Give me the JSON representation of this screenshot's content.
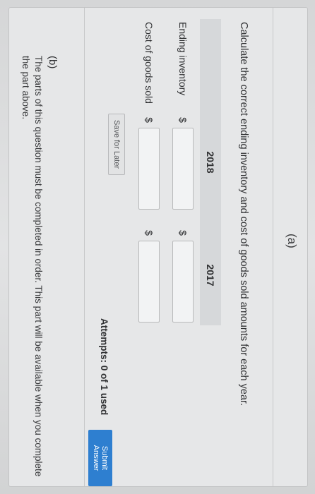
{
  "part_a": {
    "label": "(a)",
    "instructions": "Calculate the correct ending inventory and cost of goods sold amounts for each year.",
    "table": {
      "columns": [
        "2018",
        "2017"
      ],
      "rows": [
        {
          "label": "Ending inventory",
          "currency": "$",
          "values": [
            "",
            ""
          ]
        },
        {
          "label": "Cost of goods sold",
          "currency": "$",
          "values": [
            "",
            ""
          ]
        }
      ]
    },
    "save_later_label": "Save for Later",
    "attempts_text": "Attempts: 0 of 1 used",
    "submit_label": "Submit Answer"
  },
  "part_b": {
    "label": "(b)",
    "text": "The parts of this question must be completed in order. This part will be available when you complete the part above."
  },
  "colors": {
    "accent": "#2e7fd0",
    "background": "#e6e7e8",
    "header_row": "#d6d8da"
  }
}
